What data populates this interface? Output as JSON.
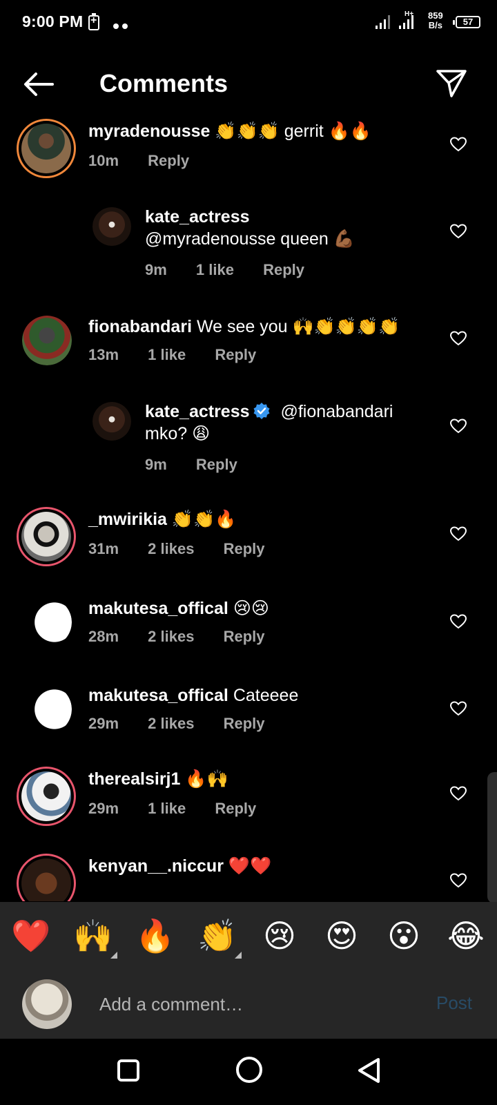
{
  "status_bar": {
    "time": "9:00 PM",
    "network_type": "H+",
    "data_speed_value": "859",
    "data_speed_unit": "B/s",
    "battery_level": "57"
  },
  "header": {
    "title": "Comments"
  },
  "comments": [
    {
      "user": "myradenousse",
      "text": "👏👏👏 gerrit 🔥🔥",
      "time": "10m",
      "likes": "",
      "reply": "Reply"
    },
    {
      "user": "kate_actress",
      "text": "@myradenousse queen 💪🏾",
      "time": "9m",
      "likes": "1 like",
      "reply": "Reply"
    },
    {
      "user": "fionabandari",
      "text": "We see you 🙌👏👏👏👏",
      "time": "13m",
      "likes": "1 like",
      "reply": "Reply"
    },
    {
      "user": "kate_actress",
      "text_line1": "@fionabandari",
      "text_line2": "mko? 😩",
      "time": "9m",
      "likes": "",
      "reply": "Reply"
    },
    {
      "user": "_mwirikia",
      "text": "👏👏🔥",
      "time": "31m",
      "likes": "2 likes",
      "reply": "Reply"
    },
    {
      "user": "makutesa_offical",
      "text": "😢😢",
      "time": "28m",
      "likes": "2 likes",
      "reply": "Reply"
    },
    {
      "user": "makutesa_offical",
      "text": "Cateeee",
      "time": "29m",
      "likes": "2 likes",
      "reply": "Reply"
    },
    {
      "user": "therealsirj1",
      "text": "🔥🙌",
      "time": "29m",
      "likes": "1 like",
      "reply": "Reply"
    },
    {
      "user": "kenyan__.niccur",
      "text": "❤️❤️",
      "time": "",
      "likes": "",
      "reply": ""
    }
  ],
  "emoji_bar": [
    "❤️",
    "🙌",
    "🔥",
    "👏",
    "😢",
    "😍",
    "😮",
    "😂"
  ],
  "composer": {
    "placeholder": "Add a comment…",
    "post_label": "Post"
  },
  "colors": {
    "background": "#000000",
    "panel": "#262626",
    "meta_text": "#a8a8a8",
    "post_disabled": "#284b66",
    "verified": "#3897f0",
    "story_ring": "#e8556c"
  }
}
